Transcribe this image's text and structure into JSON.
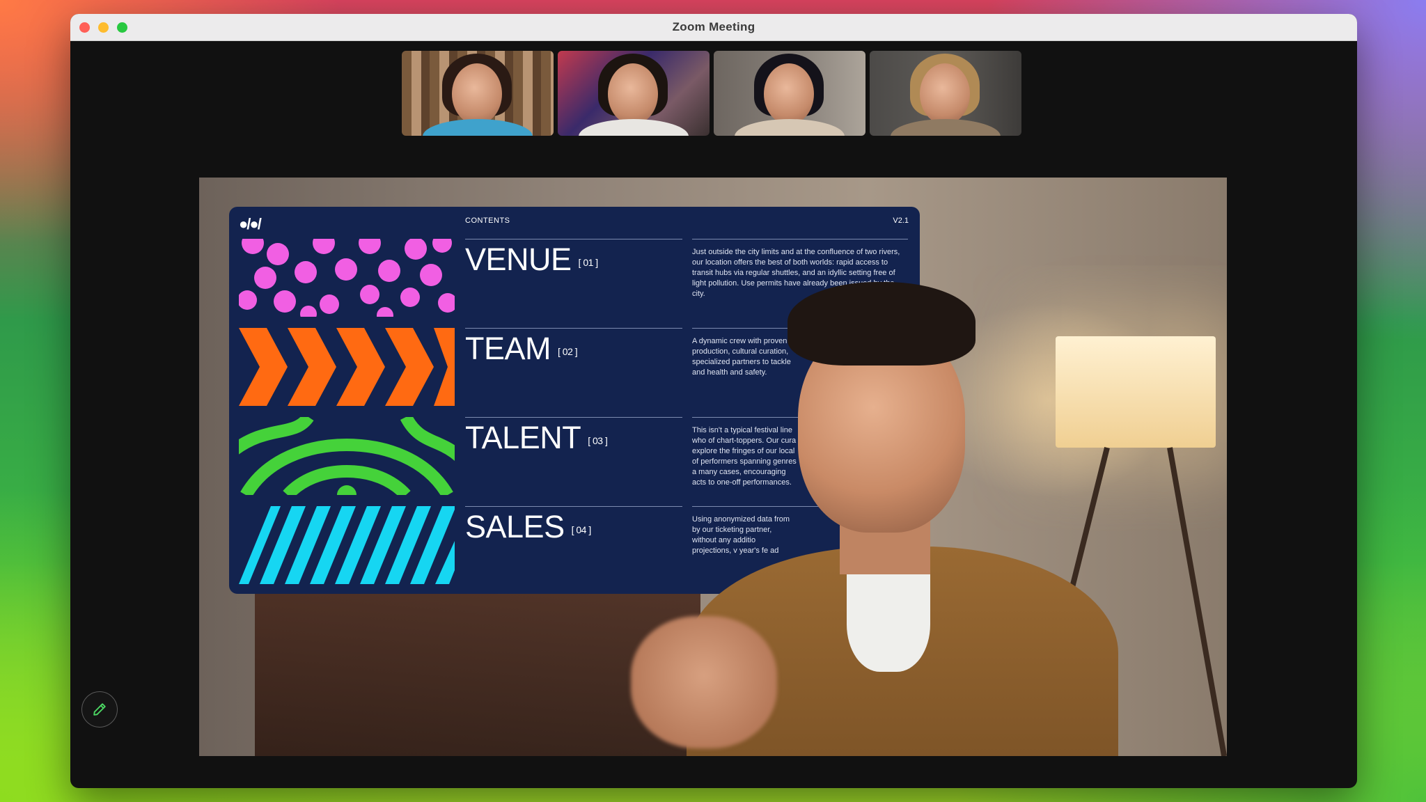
{
  "window": {
    "title": "Zoom Meeting"
  },
  "slide": {
    "logo": "●/●/",
    "contents_label": "CONTENTS",
    "version": "V2.1",
    "sections": [
      {
        "title": "VENUE",
        "num": "[ 01 ]",
        "desc": "Just outside the city limits and at the confluence of two rivers, our location offers the best of both worlds: rapid access to transit hubs via regular shuttles, and an idyllic setting free of light pollution. Use permits have already been issued by the city."
      },
      {
        "title": "TEAM",
        "num": "[ 02 ]",
        "desc": "A dynamic crew with proven t production, cultural curation, specialized partners to tackle and health and safety."
      },
      {
        "title": "TALENT",
        "num": "[ 03 ]",
        "desc": "This isn't a typical festival line who of chart-toppers. Our cura explore the fringes of our local of performers spanning genres a many cases, encouraging acts to one-off performances."
      },
      {
        "title": "SALES",
        "num": "[ 04 ]",
        "desc": "Using anonymized data from by our ticketing partner, without any additio projections, v year's fe ad"
      }
    ]
  },
  "colors": {
    "pink": "#f15fe3",
    "orange": "#ff6a12",
    "green": "#45d23a",
    "cyan": "#16d6f2",
    "slide_bg": "#13234f"
  }
}
